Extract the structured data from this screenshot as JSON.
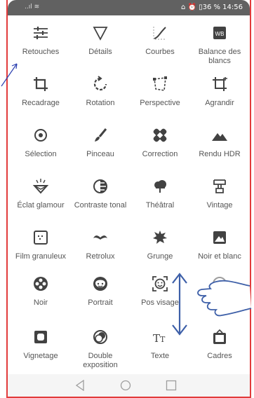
{
  "status": {
    "left": "..ıl  ≋",
    "right": "⌂ ⏰ ▯36 %  14:56"
  },
  "tools": [
    {
      "label": "Retouches",
      "icon": "tune-icon"
    },
    {
      "label": "Détails",
      "icon": "details-icon"
    },
    {
      "label": "Courbes",
      "icon": "curves-icon"
    },
    {
      "label": "Balance des blancs",
      "icon": "white-balance-icon"
    },
    {
      "label": "Recadrage",
      "icon": "crop-icon"
    },
    {
      "label": "Rotation",
      "icon": "rotate-icon"
    },
    {
      "label": "Perspective",
      "icon": "perspective-icon"
    },
    {
      "label": "Agrandir",
      "icon": "expand-icon"
    },
    {
      "label": "Sélection",
      "icon": "selective-icon"
    },
    {
      "label": "Pinceau",
      "icon": "brush-icon"
    },
    {
      "label": "Correction",
      "icon": "healing-icon"
    },
    {
      "label": "Rendu HDR",
      "icon": "hdr-icon"
    },
    {
      "label": "Éclat glamour",
      "icon": "glamour-glow-icon"
    },
    {
      "label": "Contraste tonal",
      "icon": "tonal-contrast-icon"
    },
    {
      "label": "Théâtral",
      "icon": "drama-icon"
    },
    {
      "label": "Vintage",
      "icon": "vintage-icon"
    },
    {
      "label": "Film granuleux",
      "icon": "grainy-film-icon"
    },
    {
      "label": "Retrolux",
      "icon": "retrolux-icon"
    },
    {
      "label": "Grunge",
      "icon": "grunge-icon"
    },
    {
      "label": "Noir et blanc",
      "icon": "black-white-icon"
    },
    {
      "label": "Noir",
      "icon": "noir-icon"
    },
    {
      "label": "Portrait",
      "icon": "portrait-icon"
    },
    {
      "label": "Pos visage",
      "icon": "face-pose-icon"
    },
    {
      "label": "",
      "icon": "head-icon"
    },
    {
      "label": "Vignetage",
      "icon": "vignette-icon"
    },
    {
      "label": "Double exposition",
      "icon": "double-exposure-icon"
    },
    {
      "label": "Texte",
      "icon": "text-icon"
    },
    {
      "label": "Cadres",
      "icon": "frames-icon"
    }
  ],
  "nav": {
    "back": "back-icon",
    "home": "home-icon",
    "recents": "recents-icon"
  },
  "colors": {
    "accent": "#e23b3b",
    "icon": "#424242",
    "gesture": "#3d5fa8"
  }
}
